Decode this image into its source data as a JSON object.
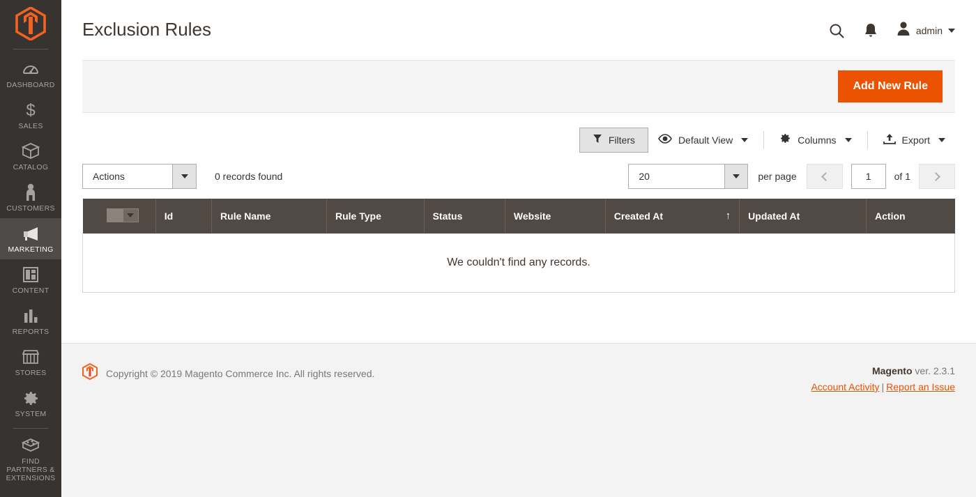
{
  "sidebar": {
    "logo_icon": "magento-logo-icon",
    "items": [
      {
        "label": "DASHBOARD",
        "icon": "dashboard-icon",
        "active": false
      },
      {
        "label": "SALES",
        "icon": "dollar-icon",
        "active": false
      },
      {
        "label": "CATALOG",
        "icon": "box-icon",
        "active": false
      },
      {
        "label": "CUSTOMERS",
        "icon": "person-icon",
        "active": false
      },
      {
        "label": "MARKETING",
        "icon": "megaphone-icon",
        "active": true
      },
      {
        "label": "CONTENT",
        "icon": "layout-icon",
        "active": false
      },
      {
        "label": "REPORTS",
        "icon": "bar-chart-icon",
        "active": false
      },
      {
        "label": "STORES",
        "icon": "storefront-icon",
        "active": false
      },
      {
        "label": "SYSTEM",
        "icon": "gear-icon",
        "active": false
      },
      {
        "label": "FIND PARTNERS & EXTENSIONS",
        "icon": "puzzle-brick-icon",
        "active": false
      }
    ]
  },
  "header": {
    "title": "Exclusion Rules",
    "search_icon": "search-icon",
    "notifications_icon": "bell-icon",
    "avatar_icon": "user-avatar-icon",
    "admin_name": "admin"
  },
  "page_actions": {
    "add_new_rule_label": "Add New Rule"
  },
  "toolbar": {
    "filters_label": "Filters",
    "filters_icon": "funnel-icon",
    "view_icon": "eye-icon",
    "view_label": "Default View",
    "columns_icon": "gear-icon",
    "columns_label": "Columns",
    "export_icon": "export-upload-icon",
    "export_label": "Export"
  },
  "grid_controls": {
    "actions_label": "Actions",
    "records_found": "0 records found",
    "per_page_value": "20",
    "per_page_label": "per page",
    "prev_icon": "chevron-left-icon",
    "next_icon": "chevron-right-icon",
    "current_page": "1",
    "of_pages": "of 1"
  },
  "grid": {
    "columns": [
      {
        "label": "",
        "key": "select"
      },
      {
        "label": "Id",
        "key": "id"
      },
      {
        "label": "Rule Name",
        "key": "rule_name"
      },
      {
        "label": "Rule Type",
        "key": "rule_type"
      },
      {
        "label": "Status",
        "key": "status"
      },
      {
        "label": "Website",
        "key": "website"
      },
      {
        "label": "Created At",
        "key": "created_at",
        "sort": "asc",
        "sort_glyph": "↑"
      },
      {
        "label": "Updated At",
        "key": "updated_at"
      },
      {
        "label": "Action",
        "key": "action"
      }
    ],
    "rows": [],
    "empty_message": "We couldn't find any records."
  },
  "footer": {
    "logo_icon": "magento-logo-icon",
    "copyright": "Copyright © 2019 Magento Commerce Inc. All rights reserved.",
    "brand": "Magento",
    "version": " ver. 2.3.1",
    "account_activity_label": "Account Activity",
    "separator": "|",
    "report_issue_label": "Report an Issue"
  },
  "colors": {
    "accent_orange": "#eb5202",
    "sidebar_bg": "#373330",
    "sidebar_active": "#4f4b48",
    "table_header_bg": "#514943",
    "page_bg": "#ffffff",
    "panel_bg": "#f5f5f5",
    "footer_bg": "#f3f3f3"
  }
}
